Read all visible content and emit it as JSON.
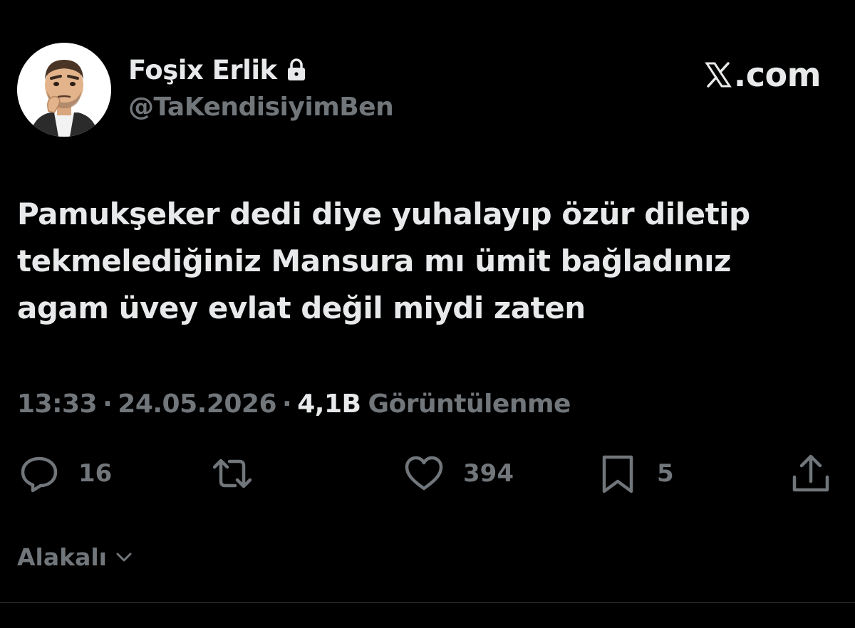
{
  "colors": {
    "background": "#000000",
    "primary_text": "#e7e9ea",
    "secondary_text": "#71767b",
    "divider": "#2f3336"
  },
  "author": {
    "display_name": "Foşix Erlik",
    "handle": "@TaKendisiyimBen",
    "avatar_icon": "cartoon-man-avatar",
    "protected_icon": "lock-icon"
  },
  "site": {
    "logo_icon": "x-logo-icon",
    "label": ".com"
  },
  "tweet": {
    "lines": [
      "Pamukşeker dedi diye yuhalayıp özür diletip",
      "tekmelediğiniz Mansura mı ümit bağladınız",
      "agam üvey evlat değil miydi zaten"
    ]
  },
  "meta": {
    "time": "13:33",
    "separator": "·",
    "date": "24.05.2026",
    "views_count": "4,1B",
    "views_label": "Görüntülenme"
  },
  "actions": {
    "reply": {
      "icon": "reply-icon",
      "count": "16"
    },
    "repost": {
      "icon": "repost-icon"
    },
    "like": {
      "icon": "heart-icon",
      "count": "394"
    },
    "bookmark": {
      "icon": "bookmark-icon",
      "count": "5"
    },
    "share": {
      "icon": "share-icon"
    }
  },
  "replies_sort": {
    "label": "Alakalı",
    "icon": "chevron-down-icon"
  }
}
